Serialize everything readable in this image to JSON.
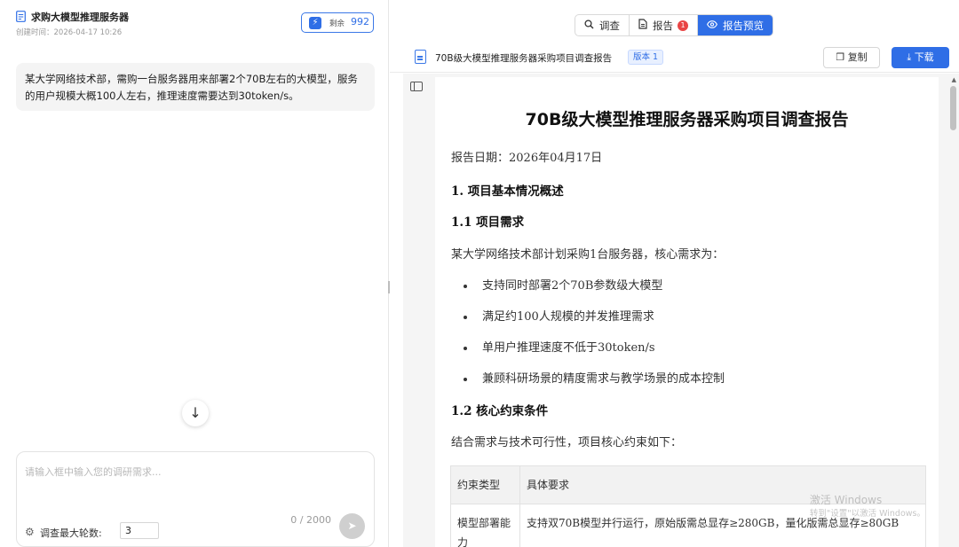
{
  "left": {
    "title": "求购大模型推理服务器",
    "created": "创建时间：2026-04-17 10:26",
    "quota_label": "剩余",
    "quota_value": "992",
    "message": "某大学网络技术部，需购一台服务器用来部署2个70B左右的大模型，服务的用户规模大概100人左右，推理速度需要达到30token/s。",
    "input_placeholder": "请输入框中输入您的调研需求...",
    "char_count": "0 / 2000",
    "rounds_label": "调查最大轮数:",
    "rounds_value": "3"
  },
  "tabs": [
    {
      "label": "调查",
      "icon": "search-icon"
    },
    {
      "label": "报告",
      "icon": "file-icon",
      "badge": "1"
    },
    {
      "label": "报告预览",
      "icon": "eye-icon",
      "active": true
    }
  ],
  "doc_bar": {
    "file_name": "70B级大模型推理服务器采购项目调查报告",
    "version": "版本 1",
    "copy_label": "复制",
    "download_label": "下载"
  },
  "report": {
    "title": "70B级大模型推理服务器采购项目调查报告",
    "date": "报告日期：2026年04月17日",
    "h1": "1. 项目基本情况概述",
    "h1_1": "1.1 项目需求",
    "p1": "某大学网络技术部计划采购1台服务器，核心需求为：",
    "items": [
      "支持同时部署2个70B参数级大模型",
      "满足约100人规模的并发推理需求",
      "单用户推理速度不低于30token/s",
      "兼顾科研场景的精度需求与教学场景的成本控制"
    ],
    "h1_2": "1.2 核心约束条件",
    "p2": "结合需求与技术可行性，项目核心约束如下：",
    "table": {
      "headers": [
        "约束类型",
        "具体要求"
      ],
      "rows": [
        [
          "模型部署能力",
          "支持双70B模型并行运行，原始版需总显存≥280GB，量化版需总显存≥80GB"
        ]
      ]
    }
  },
  "watermark": {
    "line1": "激活 Windows",
    "line2": "转到\"设置\"以激活 Windows。"
  }
}
